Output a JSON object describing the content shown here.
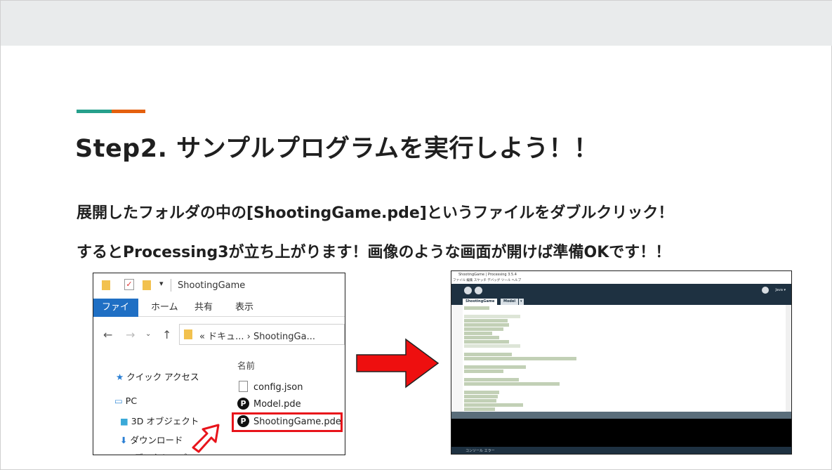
{
  "slide": {
    "title": "Step2. サンプルプログラムを実行しよう！！",
    "line1": "展開したフォルダの中の[ShootingGame.pde]というファイルをダブルクリック！",
    "line2": "するとProcessing3が立ち上がります！画像のような画面が開けば準備OKです！！",
    "accent_colors": [
      "#26a08c",
      "#e4600e"
    ]
  },
  "explorer": {
    "window_title": "ShootingGame",
    "tabs": [
      "ファイル",
      "ホーム",
      "共有",
      "表示"
    ],
    "address": "« ドキュ...  ›  ShootingGa...",
    "sidebar": [
      "クイック アクセス",
      "PC",
      "3D オブジェクト",
      "ダウンロード"
    ],
    "column_header": "名前",
    "files": [
      "config.json",
      "Model.pde",
      "ShootingGame.pde"
    ]
  },
  "processing": {
    "window_title": "ShootingGame | Processing 3.5.4",
    "menu": "ファイル 編集 スケッチ デバッグ ツール ヘルプ",
    "mode": "Java ▾",
    "tabs": [
      "ShootingGame",
      "Model"
    ],
    "bottom_tabs": "コンソール    エラー"
  },
  "colors": {
    "highlight": "#e8141b",
    "arrow": "#ee0f0f",
    "ribbon_file": "#1f6fc4"
  }
}
